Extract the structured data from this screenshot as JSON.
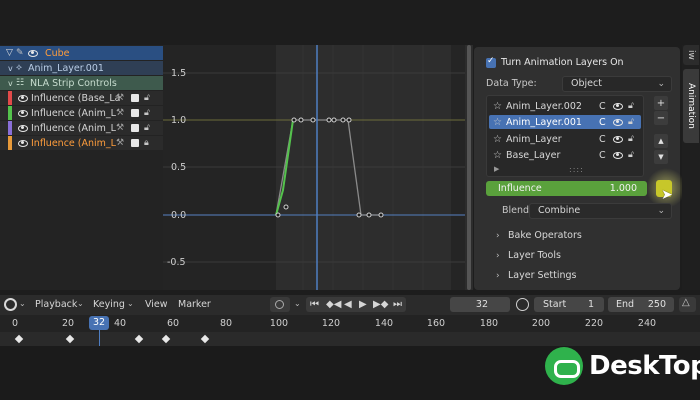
{
  "channels": {
    "object": "Cube",
    "action": "Anim_Layer.001",
    "nla": "NLA Strip Controls",
    "influences": [
      {
        "label": "Influence (Base_La",
        "color": "#e24a4a",
        "selected": false
      },
      {
        "label": "Influence (Anim_L",
        "color": "#54c24c",
        "selected": false
      },
      {
        "label": "Influence (Anim_L",
        "color": "#8a6fd8",
        "selected": false
      },
      {
        "label": "Influence (Anim_L",
        "color": "#e89a3a",
        "selected": true
      }
    ]
  },
  "graph": {
    "y_ticks": [
      "1.5",
      "1.0",
      "0.5",
      "0.0",
      "-0.5"
    ]
  },
  "sidebar": {
    "enable_label": "Turn Animation Layers On",
    "data_type_label": "Data Type:",
    "data_type_value": "Object",
    "layers": [
      {
        "name": "Anim_Layer.002",
        "flag": "C",
        "selected": false
      },
      {
        "name": "Anim_Layer.001",
        "flag": "C",
        "selected": true
      },
      {
        "name": "Anim_Layer",
        "flag": "C",
        "selected": false
      },
      {
        "name": "Base_Layer",
        "flag": "C",
        "selected": false
      }
    ],
    "add_btn": "+",
    "remove_btn": "−",
    "up_btn": "▲",
    "down_btn": "▼",
    "influence_label": "Influence",
    "influence_value": "1.000",
    "blend_label": "Blend:",
    "blend_value": "Combine",
    "sections": [
      "Bake Operators",
      "Layer Tools",
      "Layer Settings"
    ]
  },
  "tabs": {
    "top": "iw",
    "active": "Animation"
  },
  "timeline": {
    "menus": [
      "Playback",
      "Keying",
      "View",
      "Marker"
    ],
    "current_frame": "32",
    "start_label": "Start",
    "start_value": "1",
    "end_label": "End",
    "end_value": "250",
    "ticks": [
      "0",
      "20",
      "40",
      "60",
      "80",
      "100",
      "120",
      "140",
      "160",
      "180",
      "200",
      "220",
      "240"
    ],
    "playhead_label": "32"
  },
  "watermark": {
    "text": "DeskTop"
  },
  "colors": {
    "accent": "#4772b3",
    "influence_bar": "#5aa13c",
    "key_button": "#c7c72a"
  }
}
